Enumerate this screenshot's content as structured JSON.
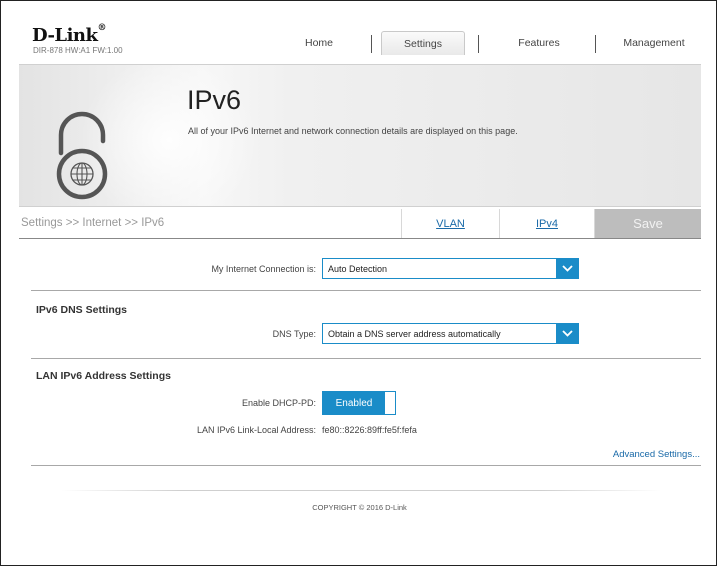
{
  "header": {
    "brand": "D-Link",
    "brand_mark": "®",
    "model": "DIR-878 HW:A1 FW:1.00",
    "nav": {
      "home": "Home",
      "settings": "Settings",
      "features": "Features",
      "management": "Management",
      "active": "Settings"
    }
  },
  "banner": {
    "title": "IPv6",
    "description": "All of your IPv6 Internet and network connection details are displayed on this page.",
    "icon": "ipv6-lock-globe-icon"
  },
  "breadcrumb": {
    "path": "Settings >> Internet >> IPv6",
    "tabs": {
      "vlan": "VLAN",
      "ipv4": "IPv4"
    },
    "save": "Save"
  },
  "form": {
    "connection_label": "My Internet Connection is:",
    "connection_value": "Auto Detection",
    "dns_section": "IPv6 DNS Settings",
    "dns_type_label": "DNS Type:",
    "dns_type_value": "Obtain a DNS server address automatically",
    "lan_section": "LAN IPv6 Address Settings",
    "dhcp_pd_label": "Enable DHCP-PD:",
    "dhcp_pd_value": "Enabled",
    "link_local_label": "LAN IPv6 Link-Local Address:",
    "link_local_value": "fe80::8226:89ff:fe5f:fefa",
    "advanced": "Advanced Settings..."
  },
  "footer": {
    "copyright": "COPYRIGHT © 2016 D-Link"
  },
  "colors": {
    "accent": "#1a8cc8",
    "link": "#1a6aa8",
    "save_disabled": "#bdbdbd"
  }
}
